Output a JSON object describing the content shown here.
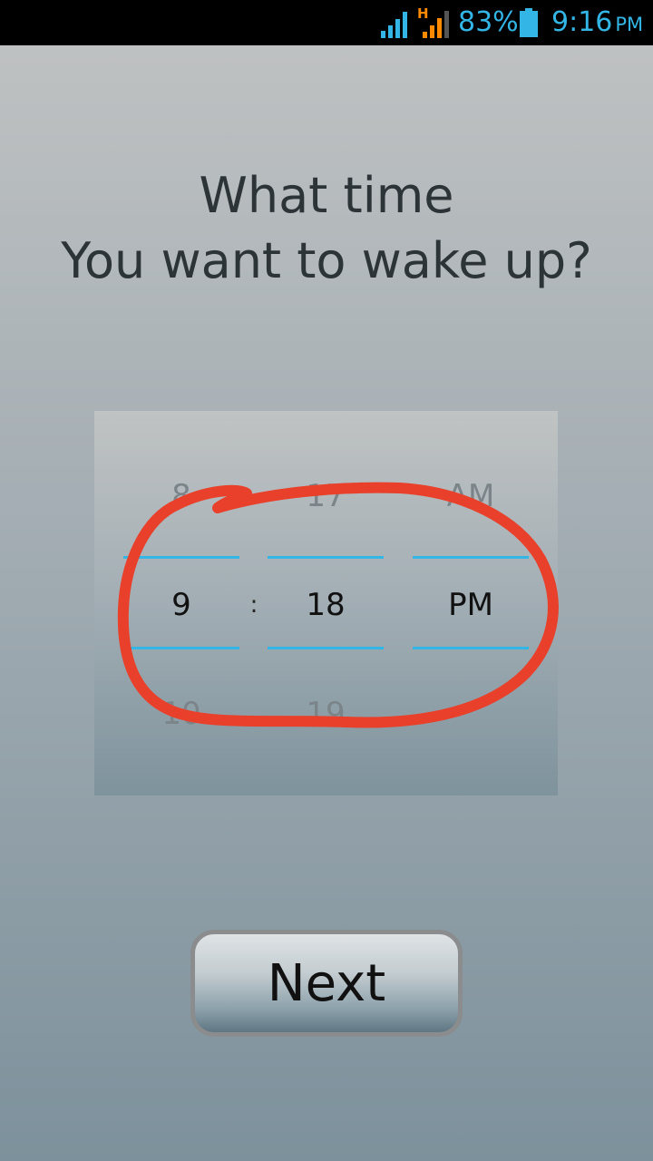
{
  "status_bar": {
    "battery_percent": "83%",
    "time": "9:16",
    "time_ampm": "PM",
    "network_type": "H",
    "icons": [
      "signal-icon",
      "h-signal-icon",
      "battery-icon"
    ],
    "accent_color": "#33b5e5"
  },
  "title": {
    "line1": "What time",
    "line2": "You want to wake up?"
  },
  "picker": {
    "hour": {
      "prev": "8",
      "current": "9",
      "next": "10"
    },
    "separator": ":",
    "minute": {
      "prev": "17",
      "current": "18",
      "next": "19"
    },
    "ampm": {
      "prev": "AM",
      "current": "PM"
    },
    "divider_color": "#33b5e5",
    "annotation_color": "#e8402a"
  },
  "next_button": {
    "label": "Next"
  }
}
